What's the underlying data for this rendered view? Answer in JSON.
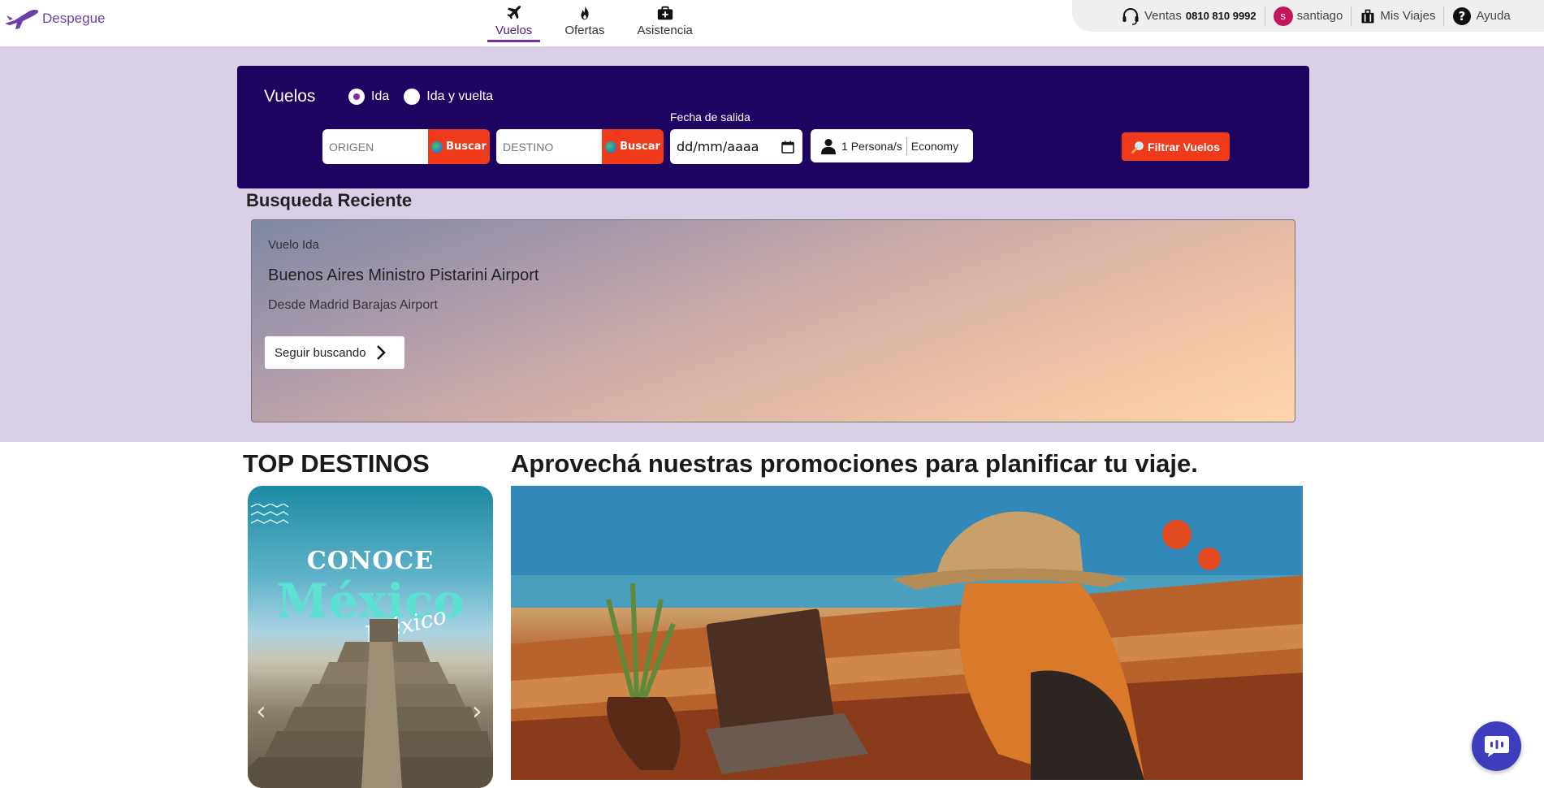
{
  "brand": {
    "name": "Despegue",
    "color": "#6b3fa8"
  },
  "nav": {
    "tabs": [
      {
        "label": "Vuelos",
        "icon": "plane-icon",
        "active": true
      },
      {
        "label": "Ofertas",
        "icon": "fire-icon",
        "active": false
      },
      {
        "label": "Asistencia",
        "icon": "medkit-icon",
        "active": false
      }
    ]
  },
  "topbar": {
    "sales_label": "Ventas",
    "sales_phone": "0810 810 9992",
    "user_initial": "s",
    "user_name": "santiago",
    "trips_label": "Mis Viajes",
    "help_label": "Ayuda"
  },
  "search": {
    "title": "Vuelos",
    "trip_types": [
      {
        "label": "Ida",
        "checked": true
      },
      {
        "label": "Ida y vuelta",
        "checked": false
      }
    ],
    "origin_placeholder": "ORIGEN",
    "destination_placeholder": "DESTINO",
    "search_button_label": "Buscar",
    "date_label": "Fecha de salida",
    "date_placeholder": "dd/mm/aaaa",
    "passengers_count": "1",
    "passengers_label": "Persona/s",
    "cabin_class": "Economy",
    "filter_button_label": "Filtrar Vuelos"
  },
  "recent": {
    "title": "Busqueda Reciente",
    "trip_type": "Vuelo Ida",
    "destination": "Buenos Aires Ministro Pistarini Airport",
    "origin": "Desde Madrid Barajas Airport",
    "continue_label": "Seguir buscando"
  },
  "top_destinations": {
    "title": "TOP DESTINOS",
    "card": {
      "line1": "CONOCE",
      "line2": "México",
      "script": "México"
    }
  },
  "promos": {
    "title": "Aprovechá nuestras promociones para planificar tu viaje."
  },
  "colors": {
    "search_bg": "#1e0461",
    "accent": "#ef3a1b",
    "band": "#d9d0e8",
    "chat": "#3d3dbd"
  }
}
